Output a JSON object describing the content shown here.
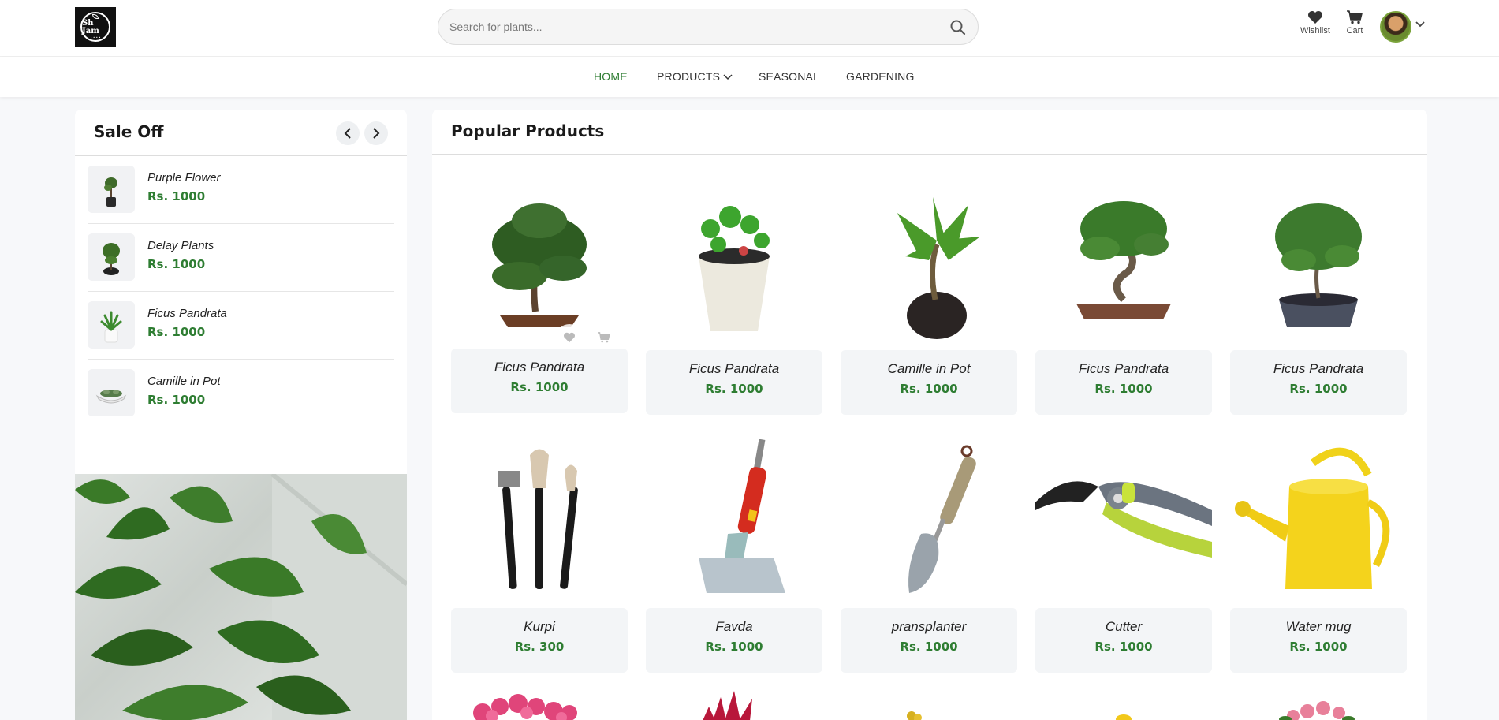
{
  "header": {
    "logo_text": "Sh Jam",
    "search": {
      "placeholder": "Search for plants..."
    },
    "wishlist_label": "Wishlist",
    "cart_label": "Cart"
  },
  "nav": {
    "items": [
      {
        "label": "HOME"
      },
      {
        "label": "PRODUCTS"
      },
      {
        "label": "SEASONAL"
      },
      {
        "label": "GARDENING"
      }
    ]
  },
  "sale": {
    "title": "Sale Off",
    "items": [
      {
        "name": "Purple Flower",
        "price": "Rs. 1000"
      },
      {
        "name": "Delay Plants",
        "price": "Rs. 1000"
      },
      {
        "name": "Ficus Pandrata",
        "price": "Rs. 1000"
      },
      {
        "name": "Camille in Pot",
        "price": "Rs. 1000"
      }
    ]
  },
  "popular": {
    "title": "Popular Products",
    "products": [
      {
        "name": "Ficus Pandrata",
        "price": "Rs. 1000"
      },
      {
        "name": "Ficus Pandrata",
        "price": "Rs. 1000"
      },
      {
        "name": "Camille in Pot",
        "price": "Rs. 1000"
      },
      {
        "name": "Ficus Pandrata",
        "price": "Rs. 1000"
      },
      {
        "name": "Ficus Pandrata",
        "price": "Rs. 1000"
      },
      {
        "name": "Kurpi",
        "price": "Rs. 300"
      },
      {
        "name": "Favda",
        "price": "Rs. 1000"
      },
      {
        "name": "pransplanter",
        "price": "Rs. 1000"
      },
      {
        "name": "Cutter",
        "price": "Rs. 1000"
      },
      {
        "name": "Water mug",
        "price": "Rs. 1000"
      }
    ]
  },
  "colors": {
    "accent": "#2e7d32",
    "text": "#222222",
    "panel": "#f3f5f7"
  }
}
